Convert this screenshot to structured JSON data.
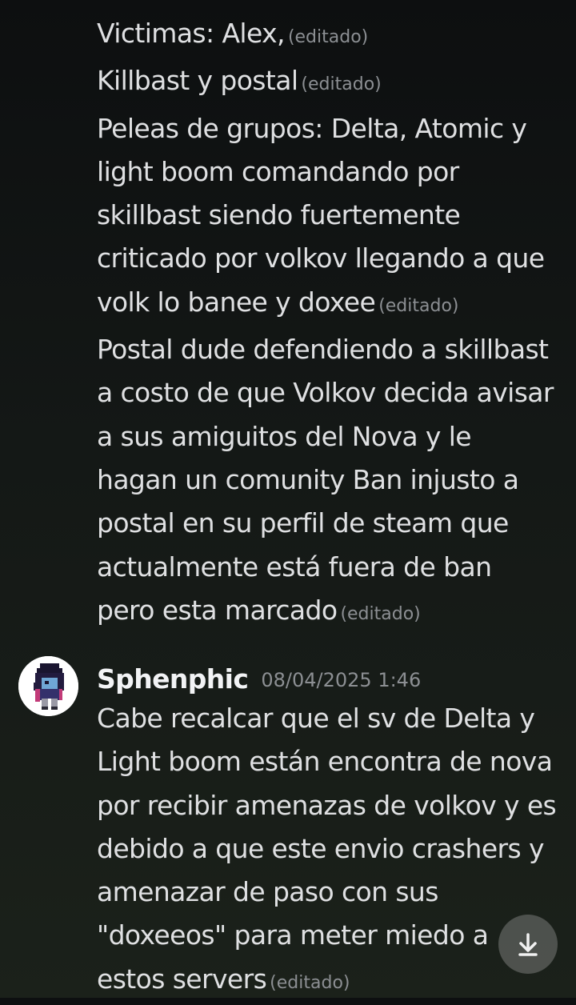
{
  "messages_top": [
    {
      "text": "Victimas: Alex,",
      "edited": "(editado)"
    },
    {
      "text": "Killbast y postal",
      "edited": "(editado)"
    },
    {
      "text": "Peleas de grupos: Delta, Atomic y light boom comandando por skillbast siendo fuertemente criticado por volkov llegando a que volk lo banee y doxee",
      "edited": "(editado)"
    },
    {
      "text": "Postal dude defendiendo a skillbast a costo de que Volkov decida avisar a sus amiguitos del Nova y le hagan un comunity Ban injusto a postal en su perfil de steam que actualmente está fuera de ban pero esta marcado",
      "edited": "(editado)"
    }
  ],
  "second_message": {
    "author": "Sphenphic",
    "timestamp": "08/04/2025 1:46",
    "text": "Cabe recalcar que el sv de Delta y Light boom están encontra de nova por recibir amenazas de volkov y es debido a que este envio crashers y amenazar de paso con sus \"doxeeos\" para meter miedo a estos servers",
    "edited": "(editado)"
  },
  "icons": {
    "avatar": "pixel-character-avatar",
    "scroll": "jump-to-bottom-icon"
  }
}
